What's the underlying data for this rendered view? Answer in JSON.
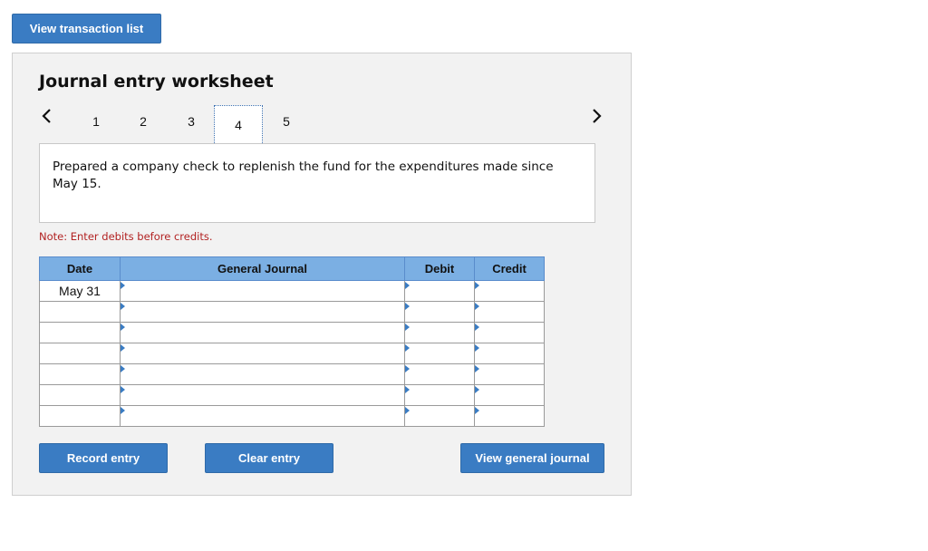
{
  "top_button": {
    "label": "View transaction list"
  },
  "worksheet": {
    "title": "Journal entry worksheet",
    "steps": [
      "1",
      "2",
      "3",
      "4",
      "5"
    ],
    "active_step": "4",
    "description": "Prepared a company check to replenish the fund for the expenditures made since May 15.",
    "note": "Note: Enter debits before credits."
  },
  "table": {
    "headers": {
      "date": "Date",
      "general_journal": "General Journal",
      "debit": "Debit",
      "credit": "Credit"
    },
    "rows": [
      {
        "date": "May 31"
      },
      {
        "date": ""
      },
      {
        "date": ""
      },
      {
        "date": ""
      },
      {
        "date": ""
      },
      {
        "date": ""
      },
      {
        "date": ""
      }
    ]
  },
  "buttons": {
    "record": "Record entry",
    "clear": "Clear entry",
    "view_journal": "View general journal"
  },
  "icons": {
    "prev": "chevron-left-icon",
    "next": "chevron-right-icon"
  },
  "colors": {
    "button_blue": "#3a7cc3",
    "header_blue": "#7bafe3",
    "note_red": "#b22222"
  }
}
